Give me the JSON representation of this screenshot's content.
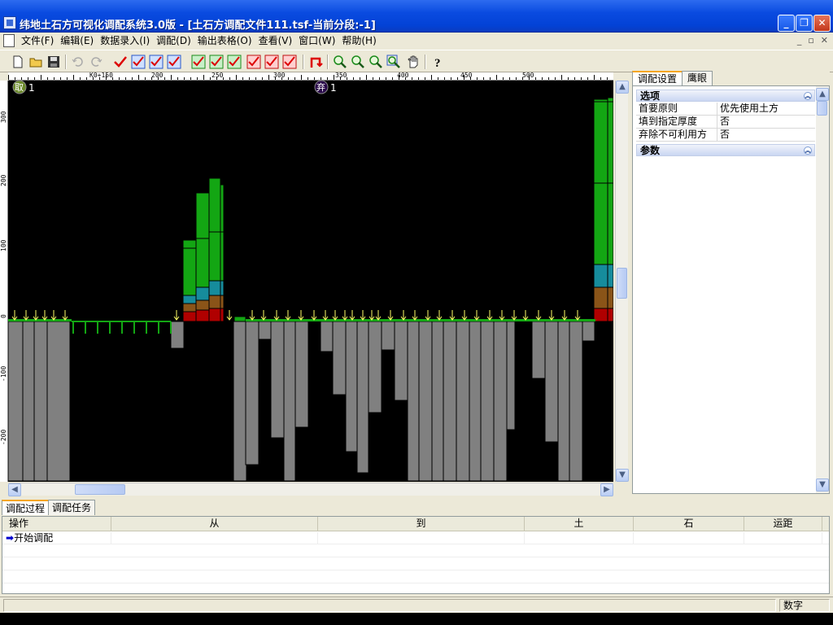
{
  "window": {
    "title": "纬地土石方可视化调配系统3.0版 - [土石方调配文件111.tsf-当前分段:-1]",
    "minimize": "_",
    "restore": "❐",
    "close": "✕"
  },
  "menu": {
    "items": [
      "文件(F)",
      "编辑(E)",
      "数据录入(I)",
      "调配(D)",
      "输出表格(O)",
      "查看(V)",
      "窗口(W)",
      "帮助(H)"
    ],
    "mdi": [
      "_",
      "▫",
      "✕"
    ]
  },
  "toolbar": {
    "icons": [
      "new-file-icon",
      "open-folder-icon",
      "save-icon",
      "undo-icon",
      "redo-icon",
      "check-icon",
      "check-box-icon-1",
      "check-box-icon-2",
      "check-box-icon-3",
      "check-green-icon-1",
      "check-green-icon-2",
      "check-green-icon-3",
      "check-red-icon-1",
      "check-red-icon-2",
      "check-red-icon-3",
      "return-arrow-icon",
      "zoom-in-icon",
      "zoom-out-icon",
      "zoom-window-icon",
      "zoom-extents-icon",
      "pan-hand-icon",
      "help-icon"
    ]
  },
  "ruler": {
    "top_labels": [
      "K0+150",
      "200",
      "250",
      "300",
      "350",
      "400",
      "450",
      "500"
    ],
    "left_labels": [
      "300",
      "200",
      "100",
      "0",
      "-100",
      "-200"
    ]
  },
  "canvas": {
    "borrow_label": "取",
    "borrow_count": "1",
    "waste_label": "弃",
    "waste_count": "1"
  },
  "right_panel": {
    "tabs": [
      "调配设置",
      "鹰眼"
    ],
    "groups": [
      {
        "name": "选项",
        "rows": [
          {
            "key": "首要原则",
            "value": "优先使用土方"
          },
          {
            "key": "填到指定厚度",
            "value": "否"
          },
          {
            "key": "弃除不可利用方",
            "value": "否"
          }
        ]
      },
      {
        "name": "参数",
        "rows": []
      }
    ],
    "collapse_glyph": "︽"
  },
  "bottom": {
    "tabs": [
      "调配过程",
      "调配任务"
    ],
    "columns": [
      "操作",
      "从",
      "到",
      "土",
      "石",
      "运距"
    ],
    "rows": [
      {
        "op": "开始调配",
        "from": "",
        "to": "",
        "soil": "",
        "rock": "",
        "dist": ""
      }
    ]
  },
  "status": {
    "mode": "数字"
  },
  "colors": {
    "titlebar": "#0a4be0",
    "canvas_bg": "#000000",
    "fill_bar": "#808080",
    "cut_green": "#13a613",
    "cut_teal": "#168c9c",
    "cut_brown": "#8a5418",
    "cut_red": "#b00000",
    "marker_yellow": "#ffff66"
  }
}
